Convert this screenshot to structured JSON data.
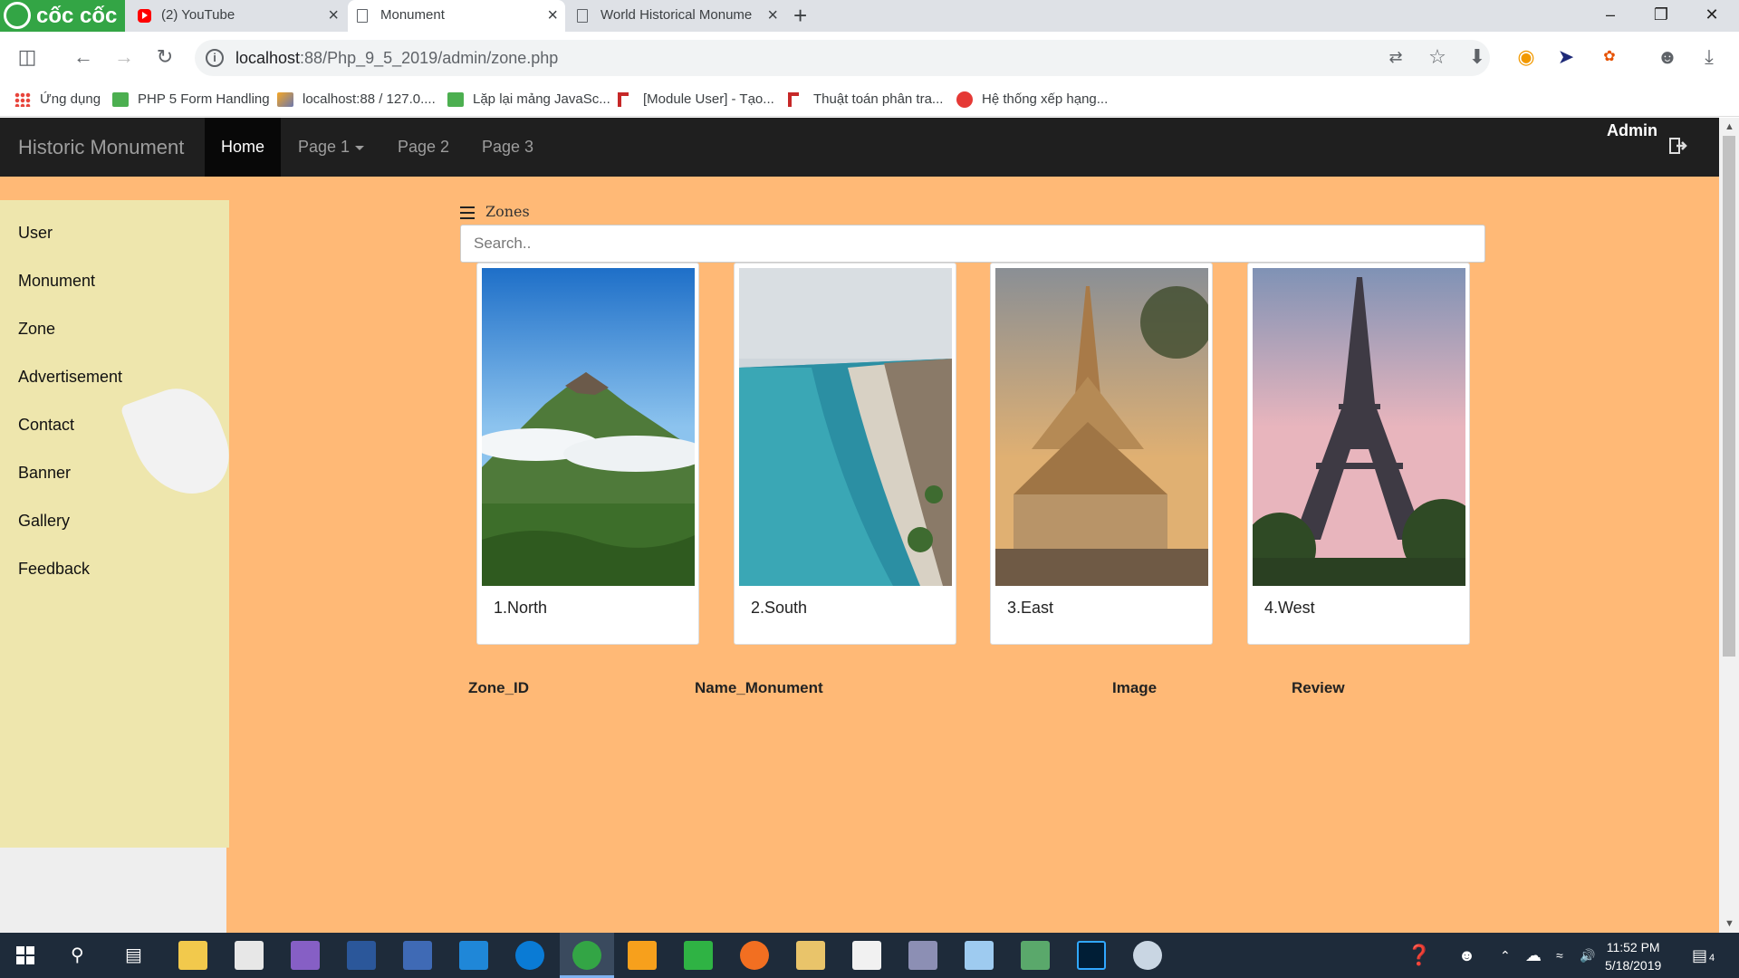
{
  "browser": {
    "brand": "cốc cốc",
    "tabs": [
      {
        "label": "(2) YouTube",
        "icon": "youtube-icon"
      },
      {
        "label": "Monument",
        "icon": "document-icon",
        "active": true
      },
      {
        "label": "World Historical Monume",
        "icon": "document-icon"
      }
    ],
    "new_tab": "+",
    "url_host": "localhost",
    "url_rest": ":88/Php_9_5_2019/admin/zone.php",
    "bookmarks": [
      {
        "label": "Ứng dụng",
        "icon": "apps-icon"
      },
      {
        "label": "PHP 5 Form Handling",
        "icon": "w3-icon"
      },
      {
        "label": "localhost:88 / 127.0....",
        "icon": "phpmyadmin-icon"
      },
      {
        "label": "Lặp lại mảng JavaSc...",
        "icon": "w3-icon"
      },
      {
        "label": "[Module User] - Tạo...",
        "icon": "flag-icon"
      },
      {
        "label": "Thuật toán phân tra...",
        "icon": "flag-icon"
      },
      {
        "label": "Hệ thống xếp hạng...",
        "icon": "code-icon"
      }
    ]
  },
  "navbar": {
    "brand": "Historic Monument",
    "items": [
      {
        "label": "Home",
        "active": true
      },
      {
        "label": "Page 1",
        "dropdown": true
      },
      {
        "label": "Page 2"
      },
      {
        "label": "Page 3"
      }
    ],
    "user": "Admin"
  },
  "sidebar": {
    "items": [
      "User",
      "Monument",
      "Zone",
      "Advertisement",
      "Contact",
      "Banner",
      "Gallery",
      "Feedback"
    ]
  },
  "main": {
    "heading": "Zones",
    "search_placeholder": "Search..",
    "cards": [
      {
        "caption": "1.North",
        "image": "mountain-photo"
      },
      {
        "caption": "2.South",
        "image": "beach-photo"
      },
      {
        "caption": "3.East",
        "image": "temple-photo"
      },
      {
        "caption": "4.West",
        "image": "eiffel-tower-photo"
      }
    ],
    "table_headers": [
      "Zone_ID",
      "Name_Monument",
      "Image",
      "Review"
    ]
  },
  "taskbar": {
    "time": "11:52 PM",
    "date": "5/18/2019",
    "notifications": "4"
  },
  "colors": {
    "page_bg": "#ffb976",
    "sidebar_bg": "#eee6ad",
    "navbar_bg": "#1f1f1f",
    "brand_green": "#33a545"
  }
}
